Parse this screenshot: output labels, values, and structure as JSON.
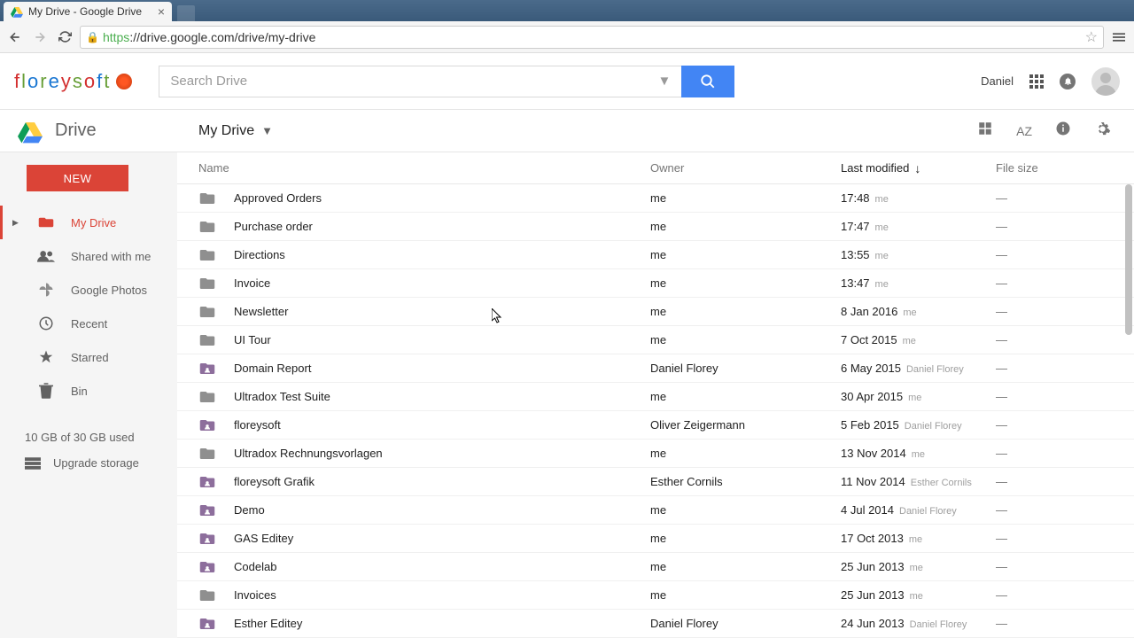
{
  "browser": {
    "tab_title": "My Drive - Google Drive",
    "url_scheme": "https",
    "url_rest": "://drive.google.com/drive/my-drive"
  },
  "header": {
    "logo_text": "floreysoft",
    "search_placeholder": "Search Drive",
    "user_name": "Daniel"
  },
  "subheader": {
    "drive_label": "Drive",
    "breadcrumb": "My Drive"
  },
  "sidebar": {
    "new_label": "NEW",
    "items": [
      {
        "label": "My Drive",
        "icon": "drive",
        "active": true,
        "expandable": true
      },
      {
        "label": "Shared with me",
        "icon": "shared",
        "active": false
      },
      {
        "label": "Google Photos",
        "icon": "photos",
        "active": false
      },
      {
        "label": "Recent",
        "icon": "recent",
        "active": false
      },
      {
        "label": "Starred",
        "icon": "starred",
        "active": false
      },
      {
        "label": "Bin",
        "icon": "bin",
        "active": false
      }
    ],
    "storage_text": "10 GB of 30 GB used",
    "upgrade_label": "Upgrade storage"
  },
  "columns": {
    "name": "Name",
    "owner": "Owner",
    "modified": "Last modified",
    "size": "File size"
  },
  "files": [
    {
      "name": "Approved Orders",
      "owner": "me",
      "modified": "17:48",
      "modified_by": "me",
      "size": "—",
      "shared": false
    },
    {
      "name": "Purchase order",
      "owner": "me",
      "modified": "17:47",
      "modified_by": "me",
      "size": "—",
      "shared": false
    },
    {
      "name": "Directions",
      "owner": "me",
      "modified": "13:55",
      "modified_by": "me",
      "size": "—",
      "shared": false
    },
    {
      "name": "Invoice",
      "owner": "me",
      "modified": "13:47",
      "modified_by": "me",
      "size": "—",
      "shared": false
    },
    {
      "name": "Newsletter",
      "owner": "me",
      "modified": "8 Jan 2016",
      "modified_by": "me",
      "size": "—",
      "shared": false
    },
    {
      "name": "UI Tour",
      "owner": "me",
      "modified": "7 Oct 2015",
      "modified_by": "me",
      "size": "—",
      "shared": false
    },
    {
      "name": "Domain Report",
      "owner": "Daniel Florey",
      "modified": "6 May 2015",
      "modified_by": "Daniel Florey",
      "size": "—",
      "shared": true
    },
    {
      "name": "Ultradox Test Suite",
      "owner": "me",
      "modified": "30 Apr 2015",
      "modified_by": "me",
      "size": "—",
      "shared": false
    },
    {
      "name": "floreysoft",
      "owner": "Oliver Zeigermann",
      "modified": "5 Feb 2015",
      "modified_by": "Daniel Florey",
      "size": "—",
      "shared": true
    },
    {
      "name": "Ultradox Rechnungsvorlagen",
      "owner": "me",
      "modified": "13 Nov 2014",
      "modified_by": "me",
      "size": "—",
      "shared": false
    },
    {
      "name": "floreysoft Grafik",
      "owner": "Esther Cornils",
      "modified": "11 Nov 2014",
      "modified_by": "Esther Cornils",
      "size": "—",
      "shared": true
    },
    {
      "name": "Demo",
      "owner": "me",
      "modified": "4 Jul 2014",
      "modified_by": "Daniel Florey",
      "size": "—",
      "shared": true
    },
    {
      "name": "GAS Editey",
      "owner": "me",
      "modified": "17 Oct 2013",
      "modified_by": "me",
      "size": "—",
      "shared": true
    },
    {
      "name": "Codelab",
      "owner": "me",
      "modified": "25 Jun 2013",
      "modified_by": "me",
      "size": "—",
      "shared": true
    },
    {
      "name": "Invoices",
      "owner": "me",
      "modified": "25 Jun 2013",
      "modified_by": "me",
      "size": "—",
      "shared": false
    },
    {
      "name": "Esther Editey",
      "owner": "Daniel Florey",
      "modified": "24 Jun 2013",
      "modified_by": "Daniel Florey",
      "size": "—",
      "shared": true
    }
  ]
}
